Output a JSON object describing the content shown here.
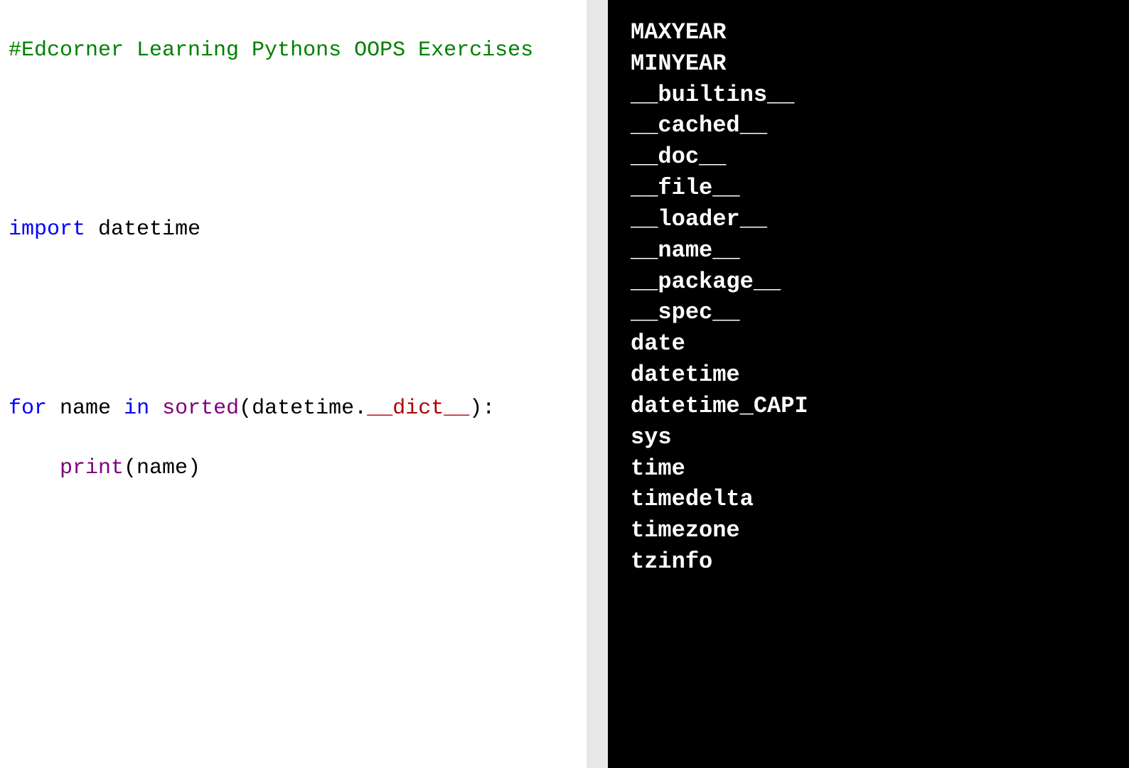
{
  "code": {
    "comment": "#Edcorner Learning Pythons OOPS Exercises",
    "line1_kw_import": "import",
    "line1_sp": " ",
    "line1_mod": "datetime",
    "for_kw": "for",
    "for_sp1": " ",
    "for_var": "name",
    "for_sp2": " ",
    "in_kw": "in",
    "for_sp3": " ",
    "sorted_fn": "sorted",
    "open_paren1": "(",
    "obj_datetime": "datetime",
    "dot": ".",
    "dunder_dict": "__dict__",
    "close_paren1": ")",
    "colon": ":",
    "indent": "    ",
    "print_fn": "print",
    "open_paren2": "(",
    "arg_name": "name",
    "close_paren2": ")"
  },
  "output": [
    "MAXYEAR",
    "MINYEAR",
    "__builtins__",
    "__cached__",
    "__doc__",
    "__file__",
    "__loader__",
    "__name__",
    "__package__",
    "__spec__",
    "date",
    "datetime",
    "datetime_CAPI",
    "sys",
    "time",
    "timedelta",
    "timezone",
    "tzinfo"
  ]
}
